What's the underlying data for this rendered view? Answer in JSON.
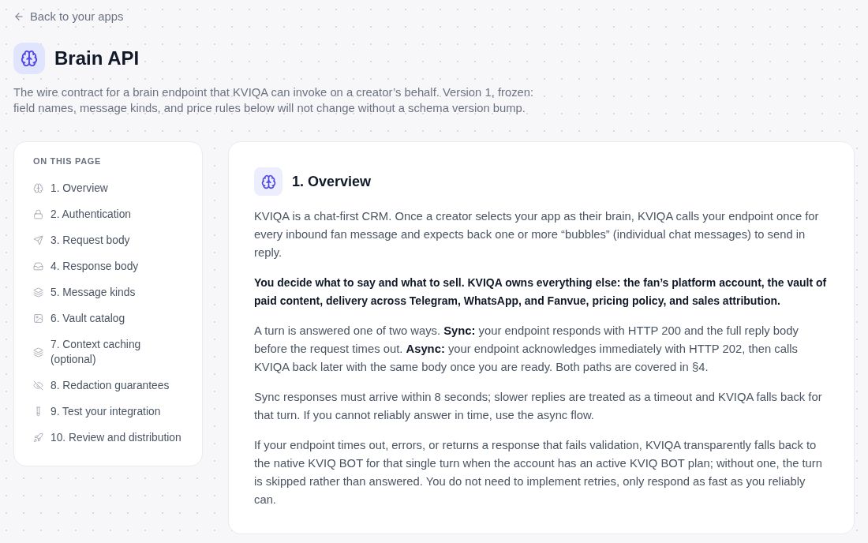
{
  "back_link": {
    "label": "Back to your apps"
  },
  "header": {
    "title": "Brain API",
    "description": "The wire contract for a brain endpoint that KVIQA can invoke on a creator’s behalf. Version 1, frozen: field names, message kinds, and price rules below will not change without a schema version bump."
  },
  "sidebar": {
    "heading": "ON THIS PAGE",
    "items": [
      {
        "label": "1. Overview"
      },
      {
        "label": "2. Authentication"
      },
      {
        "label": "3. Request body"
      },
      {
        "label": "4. Response body"
      },
      {
        "label": "5. Message kinds"
      },
      {
        "label": "6. Vault catalog"
      },
      {
        "label": "7. Context caching (optional)"
      },
      {
        "label": "8. Redaction guarantees"
      },
      {
        "label": "9. Test your integration"
      },
      {
        "label": "10. Review and distribution"
      }
    ]
  },
  "section": {
    "title": "1. Overview",
    "paragraphs": [
      {
        "kind": "text",
        "text": "KVIQA is a chat-first CRM. Once a creator selects your app as their brain, KVIQA calls your endpoint once for every inbound fan message and expects back one or more “bubbles” (individual chat messages) to send in reply."
      },
      {
        "kind": "lead",
        "text": "You decide what to say and what to sell. KVIQA owns everything else: the fan’s platform account, the vault of paid content, delivery across Telegram, WhatsApp, and Fanvue, pricing policy, and sales attribution."
      },
      {
        "kind": "text",
        "text": "A turn is answered one of two ways. **Sync:** your endpoint responds with HTTP 200 and the full reply body before the request times out. **Async:** your endpoint acknowledges immediately with HTTP 202, then calls KVIQA back later with the same body once you are ready. Both paths are covered in §4."
      },
      {
        "kind": "text",
        "text": "Sync responses must arrive within 8 seconds; slower replies are treated as a timeout and KVIQA falls back for that turn. If you cannot reliably answer in time, use the async flow."
      },
      {
        "kind": "text",
        "text": "If your endpoint times out, errors, or returns a response that fails validation, KVIQA transparently falls back to the native KVIQ BOT for that single turn when the account has an active KVIQ BOT plan; without one, the turn is skipped rather than answered. You do not need to implement retries, only respond as fast as you reliably can."
      }
    ]
  }
}
